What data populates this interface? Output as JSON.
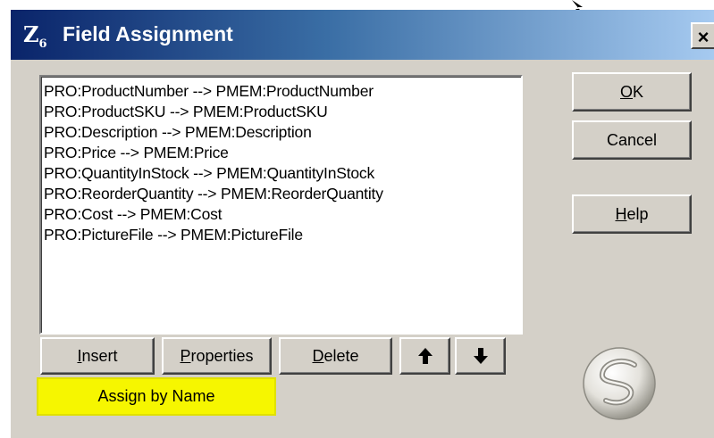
{
  "window": {
    "title": "Field Assignment",
    "icon_label": "Z",
    "icon_sub": "6",
    "close_label": "×"
  },
  "list": {
    "items": [
      "PRO:ProductNumber --> PMEM:ProductNumber",
      "PRO:ProductSKU --> PMEM:ProductSKU",
      "PRO:Description --> PMEM:Description",
      "PRO:Price --> PMEM:Price",
      "PRO:QuantityInStock --> PMEM:QuantityInStock",
      "PRO:ReorderQuantity --> PMEM:ReorderQuantity",
      "PRO:Cost --> PMEM:Cost",
      "PRO:PictureFile --> PMEM:PictureFile"
    ]
  },
  "buttons": {
    "ok": {
      "accel": "O",
      "rest": "K"
    },
    "cancel": "Cancel",
    "help": {
      "accel": "H",
      "rest": "elp"
    },
    "insert": {
      "accel": "I",
      "rest": "nsert"
    },
    "properties": {
      "accel": "P",
      "rest": "roperties"
    },
    "delete": {
      "accel": "D",
      "rest": "elete"
    },
    "up": "🡅",
    "down": "🡇",
    "assign_by_name": "Assign by Name"
  },
  "colors": {
    "highlight": "#f6f600",
    "titlebar_start": "#0a246a",
    "titlebar_end": "#a6caf0",
    "face": "#d4d0c8"
  },
  "icons": {
    "app": "app-z6-icon",
    "logo": "softvelocity-s-logo-icon",
    "up": "arrow-up-icon",
    "down": "arrow-down-icon"
  }
}
